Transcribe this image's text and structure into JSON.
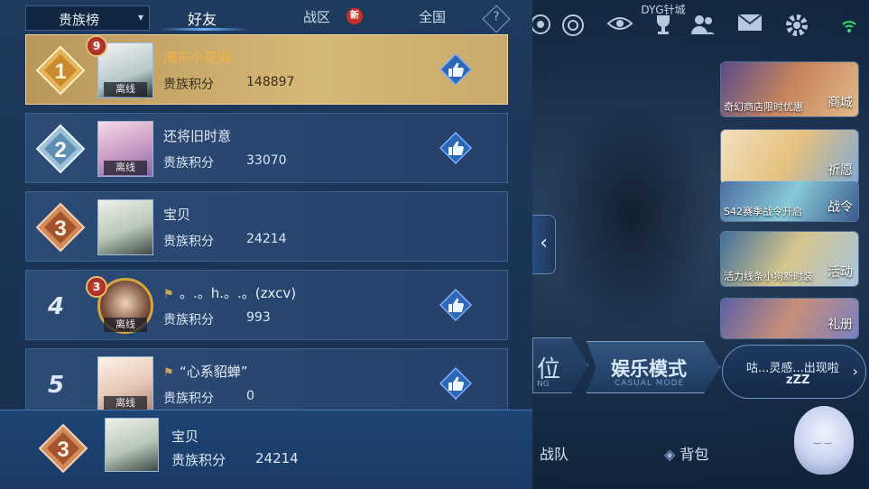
{
  "tabs": {
    "dropdown_label": "贵族榜",
    "items": [
      {
        "label": "好友",
        "active": true
      },
      {
        "label": "战区",
        "badge": "新"
      },
      {
        "label": "全国"
      }
    ],
    "help_symbol": "?"
  },
  "leaderboard": {
    "score_label": "贵族积分",
    "status_offline": "离线",
    "rows": [
      {
        "rank": "1",
        "name": "浦东小花海",
        "score": "148897",
        "level": "9",
        "offline": true,
        "like": true
      },
      {
        "rank": "2",
        "name": "还将旧时意",
        "score": "33070",
        "level": "",
        "offline": true,
        "like": true
      },
      {
        "rank": "3",
        "name": "宝贝",
        "score": "24214",
        "level": "",
        "offline": false,
        "like": false
      },
      {
        "rank": "4",
        "name": "。.。h.。.。(zxcv)",
        "score": "993",
        "level": "3",
        "offline": true,
        "like": true
      },
      {
        "rank": "5",
        "name": "“心系貂蝉”",
        "score": "0",
        "level": "",
        "offline": true,
        "like": true
      }
    ],
    "self": {
      "rank": "3",
      "name": "宝贝",
      "score": "24214"
    }
  },
  "lobby": {
    "top_label": "DYG针城",
    "side_cards": [
      {
        "caption": "奇幻商店限时优惠",
        "tag": "商城"
      },
      {
        "caption": "",
        "tag": "祈愿"
      },
      {
        "caption": "S42赛季战令开启",
        "tag": "战令"
      },
      {
        "caption": "活力线条小狗新时装",
        "tag": "活动"
      },
      {
        "caption": "",
        "tag": "礼册"
      }
    ],
    "mode_left": {
      "title": "位",
      "sub": "NG"
    },
    "mode_button": {
      "title": "娱乐模式",
      "sub": "CASUAL MODE"
    },
    "whisper": {
      "line1": "咕...灵感...出现啦",
      "line2": "zZZ"
    },
    "bottom_tabs": [
      "战队",
      "背包"
    ],
    "colors": {
      "accent": "#6ab0ff",
      "gold": "#f2b243",
      "new_badge": "#c6302b"
    }
  }
}
